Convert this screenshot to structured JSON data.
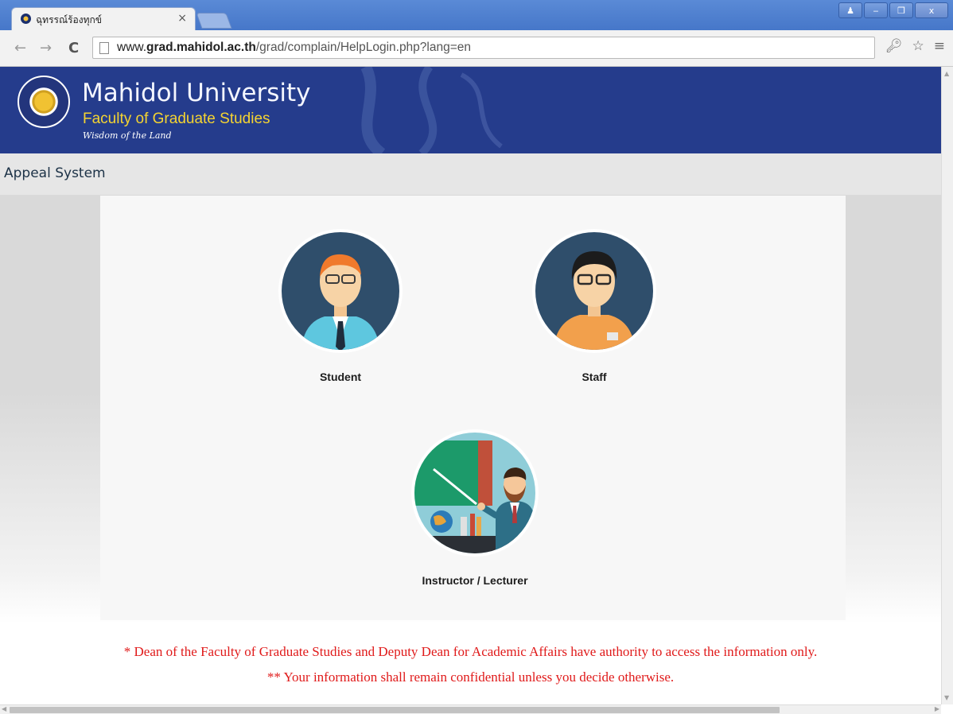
{
  "browser": {
    "tab_title": "ฉุทรรณ์ร้องทุกข์",
    "tab_close": "×",
    "url_prefix": "www.",
    "url_host": "grad.mahidol.ac.th",
    "url_path": "/grad/complain/HelpLogin.php?lang=en",
    "window_buttons": {
      "profile": "♟",
      "minimize": "‒",
      "restore": "❐",
      "close": "x"
    }
  },
  "header": {
    "university": "Mahidol University",
    "faculty": "Faculty of Graduate Studies",
    "motto": "Wisdom of the Land"
  },
  "system_bar": {
    "title": "Appeal System"
  },
  "roles": [
    {
      "label": "Student"
    },
    {
      "label": "Staff"
    },
    {
      "label": "Instructor / Lecturer"
    }
  ],
  "notes": {
    "line1": "* Dean of the Faculty of Graduate Studies and Deputy Dean for Academic Affairs have authority to access the information only.",
    "line2": "** Your information shall remain confidential unless you decide otherwise."
  },
  "colors": {
    "banner": "#253c8c",
    "faculty_text": "#f5d431",
    "note_text": "#e01a1a",
    "avatar_circle": "#2f4e6b"
  }
}
